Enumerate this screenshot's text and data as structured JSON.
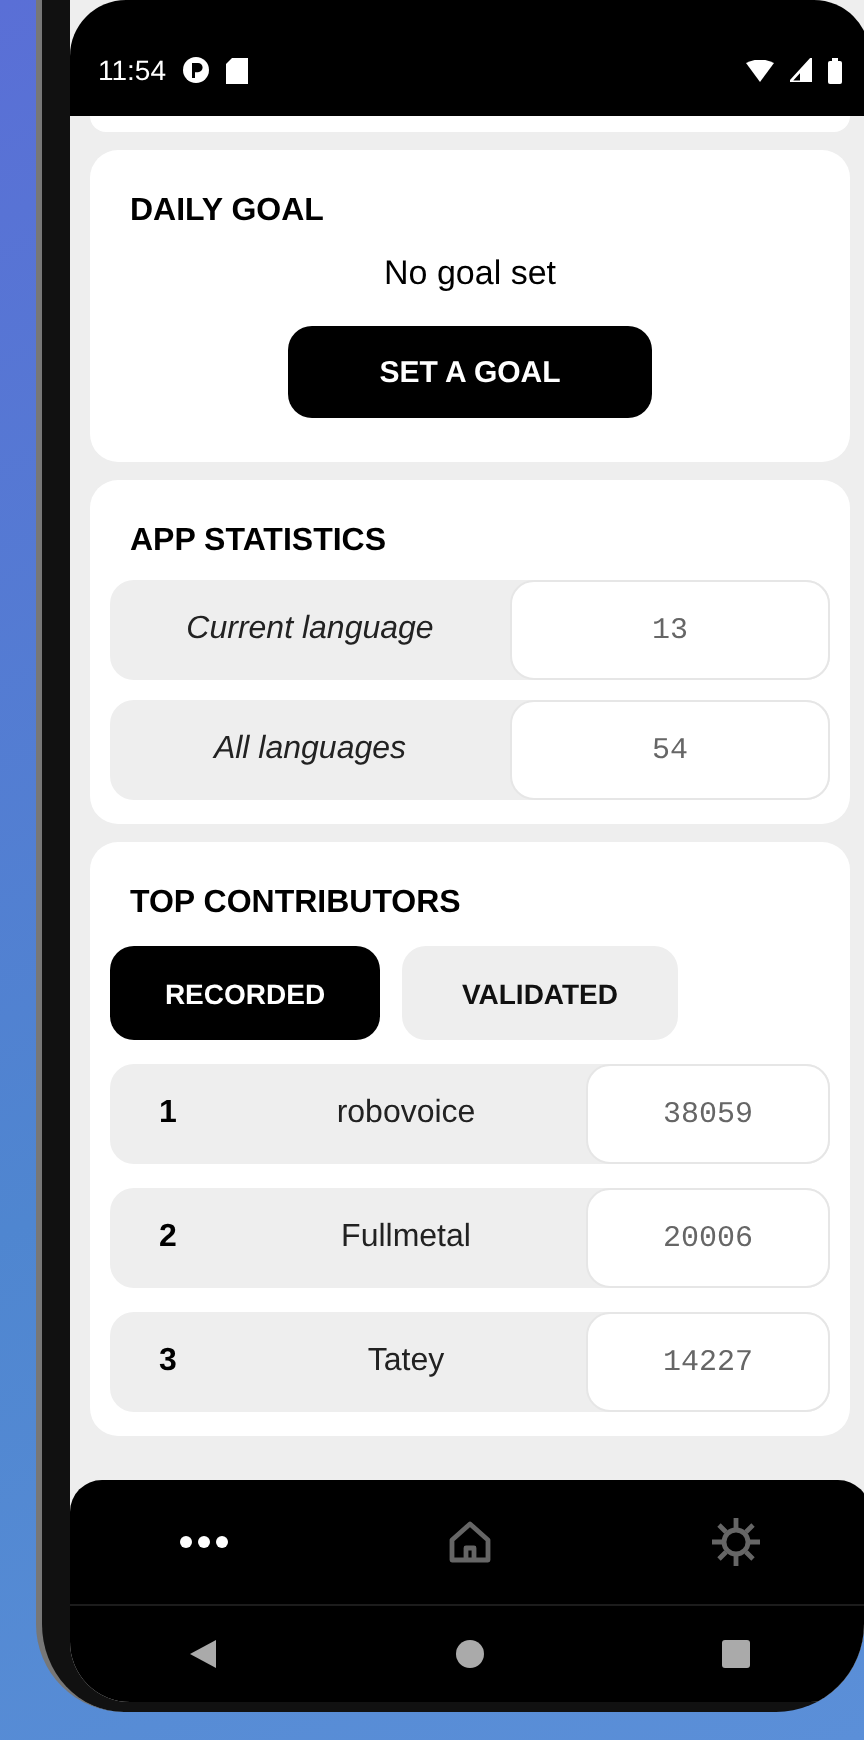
{
  "status_bar": {
    "time": "11:54"
  },
  "daily_goal": {
    "title": "DAILY GOAL",
    "message": "No goal set",
    "button": "SET A GOAL"
  },
  "app_statistics": {
    "title": "APP STATISTICS",
    "rows": [
      {
        "label": "Current language",
        "value": "13"
      },
      {
        "label": "All languages",
        "value": "54"
      }
    ]
  },
  "top_contributors": {
    "title": "TOP CONTRIBUTORS",
    "tabs": [
      {
        "label": "RECORDED",
        "selected": true
      },
      {
        "label": "VALIDATED",
        "selected": false
      }
    ],
    "rows": [
      {
        "rank": "1",
        "name": "robovoice",
        "count": "38059"
      },
      {
        "rank": "2",
        "name": "Fullmetal",
        "count": "20006"
      },
      {
        "rank": "3",
        "name": "Tatey",
        "count": "14227"
      }
    ]
  },
  "bottom_nav": [
    {
      "kind": "more",
      "selected": true
    },
    {
      "kind": "home",
      "selected": false
    },
    {
      "kind": "settings",
      "selected": false
    }
  ]
}
